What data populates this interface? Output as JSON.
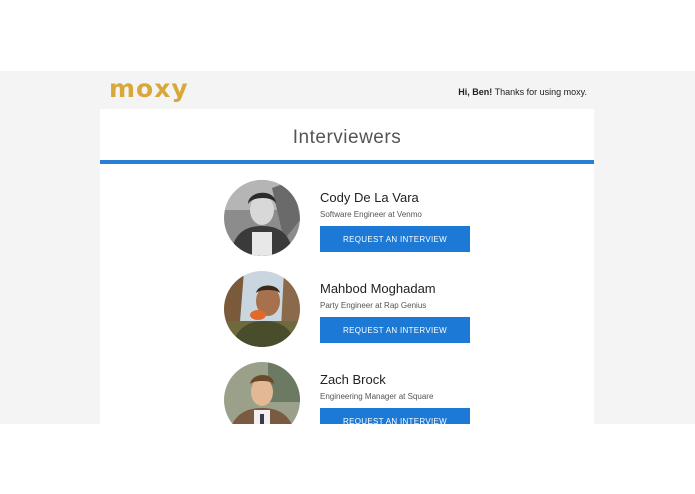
{
  "header": {
    "logo_text": "moxy",
    "greeting_name": "Hi, Ben!",
    "greeting_rest": " Thanks for using moxy."
  },
  "colors": {
    "brand": "#d9a83a",
    "accent": "#1c7ad6",
    "background": "#f4f4f4"
  },
  "page": {
    "title": "Interviewers"
  },
  "interviewers": [
    {
      "name": "Cody De La Vara",
      "role": "Software Engineer at Venmo",
      "button_label": "REQUEST AN INTERVIEW"
    },
    {
      "name": "Mahbod Moghadam",
      "role": "Party Engineer at Rap Genius",
      "button_label": "REQUEST AN INTERVIEW"
    },
    {
      "name": "Zach Brock",
      "role": "Engineering Manager at Square",
      "button_label": "REQUEST AN INTERVIEW"
    }
  ]
}
